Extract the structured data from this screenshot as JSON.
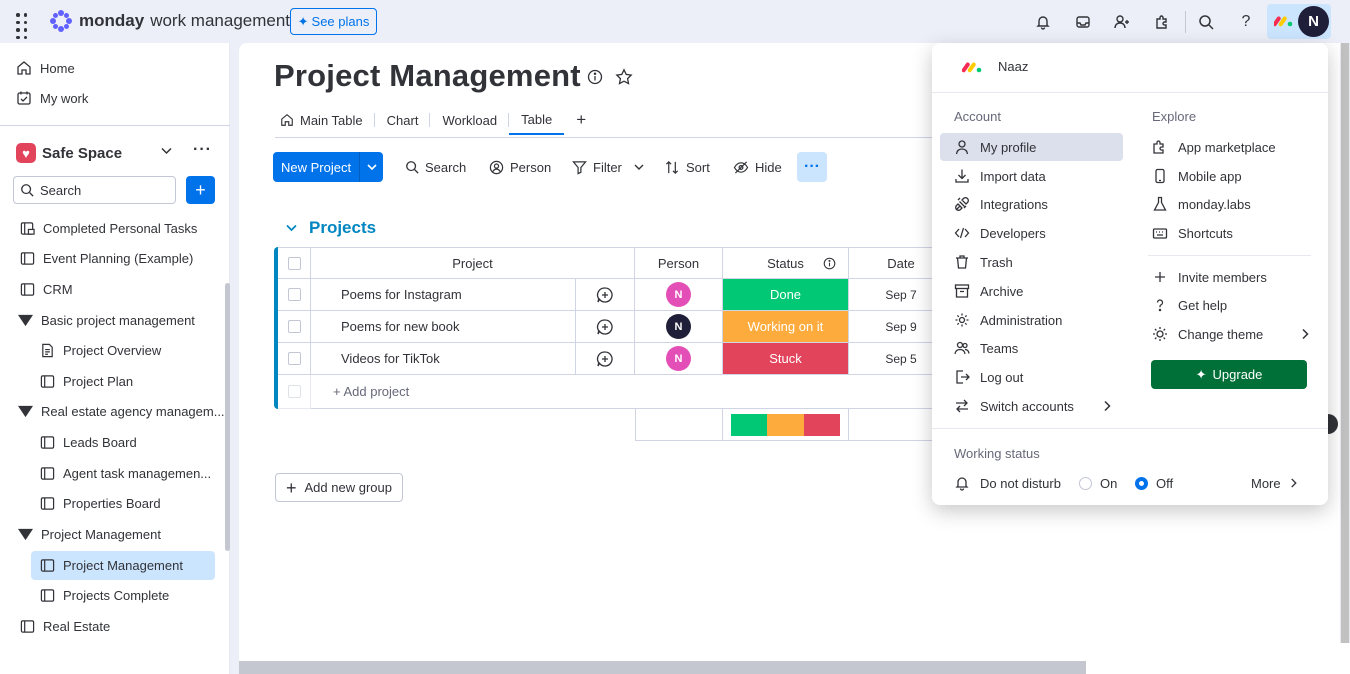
{
  "topbar": {
    "brand_bold": "monday",
    "brand_light": "work management",
    "see_plans": "See plans",
    "avatar_initial": "N"
  },
  "sidebar": {
    "home": "Home",
    "my_work": "My work",
    "workspace": "Safe Space",
    "search_placeholder": "Search",
    "items": [
      {
        "label": "Completed Personal Tasks"
      },
      {
        "label": "Event Planning (Example)"
      },
      {
        "label": "CRM"
      },
      {
        "label": "Basic project management"
      },
      {
        "label": "Project Overview"
      },
      {
        "label": "Project Plan"
      },
      {
        "label": "Real estate agency managem..."
      },
      {
        "label": "Leads Board"
      },
      {
        "label": "Agent task managemen..."
      },
      {
        "label": "Properties Board"
      },
      {
        "label": "Project Management"
      },
      {
        "label": "Project Management"
      },
      {
        "label": "Projects Complete"
      },
      {
        "label": "Real Estate"
      }
    ]
  },
  "main": {
    "title": "Project Management",
    "tabs": [
      {
        "label": "Main Table"
      },
      {
        "label": "Chart"
      },
      {
        "label": "Workload"
      },
      {
        "label": "Table"
      }
    ],
    "toolbar": {
      "new_project": "New Project",
      "search": "Search",
      "person": "Person",
      "filter": "Filter",
      "sort": "Sort",
      "hide": "Hide"
    },
    "group_title": "Projects",
    "columns": {
      "project": "Project",
      "person": "Person",
      "status": "Status",
      "date": "Date"
    },
    "rows": [
      {
        "name": "Poems for Instagram",
        "person": "N",
        "person_color": "#e44fb7",
        "status": "Done",
        "status_color": "#00c875",
        "date": "Sep 7"
      },
      {
        "name": "Poems for new book",
        "person": "N",
        "person_color": "#1f1f39",
        "status": "Working on it",
        "status_color": "#fdab3d",
        "date": "Sep 9"
      },
      {
        "name": "Videos for TikTok",
        "person": "N",
        "person_color": "#e44fb7",
        "status": "Stuck",
        "status_color": "#e2445c",
        "date": "Sep 5"
      }
    ],
    "add_item": "+ Add project",
    "add_group": "Add new group",
    "status_summary": [
      {
        "color": "#00c875",
        "share": 0.333
      },
      {
        "color": "#fdab3d",
        "share": 0.333
      },
      {
        "color": "#e2445c",
        "share": 0.334
      }
    ]
  },
  "menu": {
    "user_name": "Naaz",
    "account_heading": "Account",
    "explore_heading": "Explore",
    "account_items": [
      {
        "label": "My profile"
      },
      {
        "label": "Import data"
      },
      {
        "label": "Integrations"
      },
      {
        "label": "Developers"
      },
      {
        "label": "Trash"
      },
      {
        "label": "Archive"
      },
      {
        "label": "Administration"
      },
      {
        "label": "Teams"
      },
      {
        "label": "Log out"
      },
      {
        "label": "Switch accounts"
      }
    ],
    "explore_items": [
      {
        "label": "App marketplace"
      },
      {
        "label": "Mobile app"
      },
      {
        "label": "monday.labs"
      },
      {
        "label": "Shortcuts"
      },
      {
        "label": "Invite members"
      },
      {
        "label": "Get help"
      },
      {
        "label": "Change theme"
      }
    ],
    "upgrade": "Upgrade",
    "working_status_heading": "Working status",
    "do_not_disturb": "Do not disturb",
    "on": "On",
    "off": "Off",
    "more": "More"
  },
  "colors": {
    "accent": "#0073ea",
    "group": "#0086c0",
    "upgrade": "#007038"
  }
}
